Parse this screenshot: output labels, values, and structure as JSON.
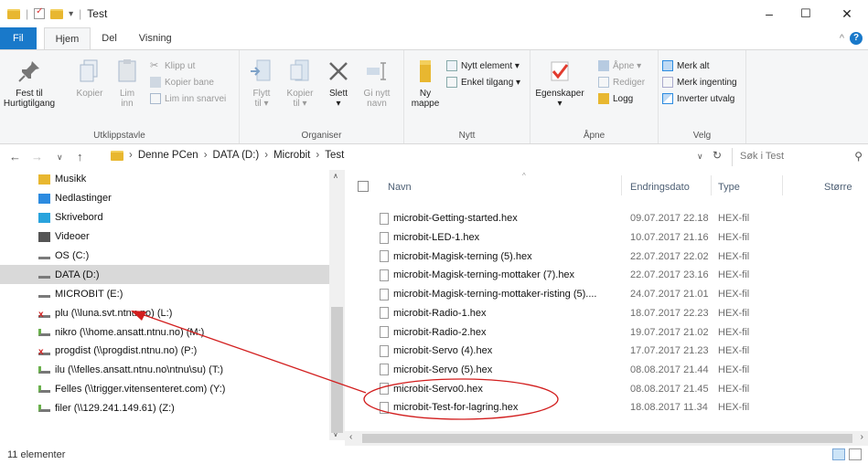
{
  "window": {
    "title": "Test",
    "minimize_glyph": "–",
    "maximize_glyph": "☐",
    "close_glyph": "✕"
  },
  "tabs": {
    "file": "Fil",
    "home": "Hjem",
    "share": "Del",
    "view": "Visning"
  },
  "ribbon": {
    "clipboard": {
      "pin": "Fest til\nHurtigtilgang",
      "copy": "Kopier",
      "paste": "Lim\ninn",
      "cut": "Klipp ut",
      "copy_path": "Kopier bane",
      "paste_shortcut": "Lim inn snarvei",
      "label": "Utklippstavle"
    },
    "organize": {
      "move_to": "Flytt\ntil ▾",
      "copy_to": "Kopier\ntil ▾",
      "delete": "Slett\n▾",
      "rename": "Gi nytt\nnavn",
      "label": "Organiser"
    },
    "new": {
      "new_folder": "Ny\nmappe",
      "new_item": "Nytt element ▾",
      "easy_access": "Enkel tilgang ▾",
      "label": "Nytt"
    },
    "open": {
      "properties": "Egenskaper\n▾",
      "open": "Åpne ▾",
      "edit": "Rediger",
      "history": "Logg",
      "label": "Åpne"
    },
    "select": {
      "select_all": "Merk alt",
      "select_none": "Merk ingenting",
      "invert": "Inverter utvalg",
      "label": "Velg"
    }
  },
  "address": {
    "crumbs": [
      "Denne PCen",
      "DATA (D:)",
      "Microbit",
      "Test"
    ],
    "search_placeholder": "Søk i Test"
  },
  "nav": {
    "items": [
      {
        "label": "Musikk",
        "icon": "music-folder-icon",
        "color": "#e8b730"
      },
      {
        "label": "Nedlastinger",
        "icon": "downloads-folder-icon",
        "color": "#2c8be0"
      },
      {
        "label": "Skrivebord",
        "icon": "desktop-folder-icon",
        "color": "#29a3dd"
      },
      {
        "label": "Videoer",
        "icon": "videos-folder-icon",
        "color": "#555555"
      },
      {
        "label": "OS (C:)",
        "icon": "windows-drive-icon",
        "color": "#7a7a7a"
      },
      {
        "label": "DATA (D:)",
        "icon": "drive-icon",
        "color": "#7a7a7a"
      },
      {
        "label": "MICROBIT (E:)",
        "icon": "drive-icon",
        "color": "#7a7a7a"
      },
      {
        "label": "plu (\\\\luna.svt.ntnu.no) (L:)",
        "icon": "disconnected-network-drive-icon",
        "color": "#d11f1f"
      },
      {
        "label": "nikro (\\\\home.ansatt.ntnu.no) (M:)",
        "icon": "network-drive-icon",
        "color": "#6ab04c"
      },
      {
        "label": "progdist (\\\\progdist.ntnu.no) (P:)",
        "icon": "disconnected-network-drive-icon",
        "color": "#d11f1f"
      },
      {
        "label": "ilu (\\\\felles.ansatt.ntnu.no\\ntnu\\su) (T:)",
        "icon": "network-drive-icon",
        "color": "#6ab04c"
      },
      {
        "label": "Felles (\\\\trigger.vitensenteret.com) (Y:)",
        "icon": "network-drive-icon",
        "color": "#6ab04c"
      },
      {
        "label": "filer (\\\\129.241.149.61) (Z:)",
        "icon": "network-drive-icon",
        "color": "#6ab04c"
      }
    ]
  },
  "files": {
    "headers": {
      "name": "Navn",
      "date": "Endringsdato",
      "type": "Type",
      "size": "Større"
    },
    "rows": [
      {
        "name": "microbit-Getting-started.hex",
        "date": "09.07.2017 22.18",
        "type": "HEX-fil"
      },
      {
        "name": "microbit-LED-1.hex",
        "date": "10.07.2017 21.16",
        "type": "HEX-fil"
      },
      {
        "name": "microbit-Magisk-terning (5).hex",
        "date": "22.07.2017 22.02",
        "type": "HEX-fil"
      },
      {
        "name": "microbit-Magisk-terning-mottaker (7).hex",
        "date": "22.07.2017 23.16",
        "type": "HEX-fil"
      },
      {
        "name": "microbit-Magisk-terning-mottaker-risting (5)....",
        "date": "24.07.2017 21.01",
        "type": "HEX-fil"
      },
      {
        "name": "microbit-Radio-1.hex",
        "date": "18.07.2017 22.23",
        "type": "HEX-fil"
      },
      {
        "name": "microbit-Radio-2.hex",
        "date": "19.07.2017 21.02",
        "type": "HEX-fil"
      },
      {
        "name": "microbit-Servo (4).hex",
        "date": "17.07.2017 21.23",
        "type": "HEX-fil"
      },
      {
        "name": "microbit-Servo (5).hex",
        "date": "08.08.2017 21.44",
        "type": "HEX-fil"
      },
      {
        "name": "microbit-Servo0.hex",
        "date": "08.08.2017 21.45",
        "type": "HEX-fil"
      },
      {
        "name": "microbit-Test-for-lagring.hex",
        "date": "18.08.2017 11.34",
        "type": "HEX-fil"
      }
    ]
  },
  "status": {
    "count": "11 elementer"
  },
  "annotation": {
    "color": "#d21e1e"
  }
}
